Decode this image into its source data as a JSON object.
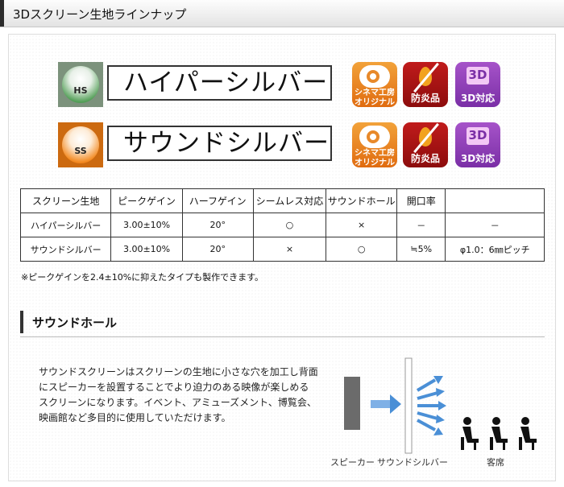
{
  "header": {
    "title": "3Dスクリーン生地ラインナップ"
  },
  "products": [
    {
      "code": "HS",
      "name": "ハイパーシルバー",
      "badge_color": "#7c927c",
      "icons": [
        {
          "name": "cinema-koubou-icon",
          "text": "シネマ工房\nオリジナル"
        },
        {
          "name": "fireproof-icon",
          "text": "防炎品"
        },
        {
          "name": "3d-icon",
          "text": "3D対応"
        }
      ]
    },
    {
      "code": "SS",
      "name": "サウンドシルバー",
      "badge_color": "#cc6a10",
      "icons": [
        {
          "name": "cinema-koubou-icon",
          "text": "シネマ工房\nオリジナル"
        },
        {
          "name": "fireproof-icon",
          "text": "防炎品"
        },
        {
          "name": "3d-icon",
          "text": "3D対応"
        }
      ]
    }
  ],
  "table": {
    "headers": [
      "スクリーン生地",
      "ピークゲイン",
      "ハーフゲイン",
      "シームレス対応",
      "サウンドホール",
      "開口率",
      ""
    ],
    "rows": [
      [
        "ハイパーシルバー",
        "3.00±10%",
        "20°",
        "○",
        "×",
        "－",
        "－"
      ],
      [
        "サウンドシルバー",
        "3.00±10%",
        "20°",
        "×",
        "○",
        "≒5%",
        "φ1.0：6㎜ピッチ"
      ]
    ]
  },
  "note": "※ピークゲインを2.4±10%に抑えたタイプも製作できます。",
  "section": {
    "title": "サウンドホール",
    "lines": [
      "サウンドスクリーンはスクリーンの生地に小さな穴を加工し背面",
      "にスピーカーを設置することでより迫力のある映像が楽しめる",
      "スクリーンになります。イベント、アミューズメント、博覧会、",
      "映画館など多目的に使用していただけます。"
    ]
  },
  "diagram": {
    "speaker_label": "スピーカー",
    "screen_label": "サウンドシルバー",
    "audience_label": "客席",
    "arrow_color": "#4a8fd6"
  }
}
